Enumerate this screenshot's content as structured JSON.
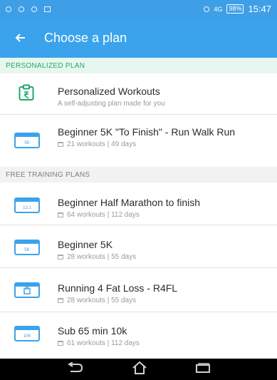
{
  "status_bar": {
    "network": "4G",
    "battery": "98%",
    "time": "15:47"
  },
  "app_bar": {
    "title": "Choose a plan",
    "back_icon": "back-arrow-icon"
  },
  "sections": {
    "personalized_header": "PERSONALIZED PLAN",
    "free_header": "FREE TRAINING PLANS"
  },
  "plans": [
    {
      "title": "Personalized Workouts",
      "subtitle": "A self-adjusting plan made for you",
      "icon": "personalized-icon"
    },
    {
      "title": "Beginner 5K \"To Finish\" -  Run Walk Run",
      "subtitle": "21 workouts | 49 days",
      "icon_label": "5K"
    },
    {
      "title": "Beginner Half Marathon to finish",
      "subtitle": "64 workouts | 112 days",
      "icon_label": "13.1"
    },
    {
      "title": "Beginner 5K",
      "subtitle": "28 workouts | 55 days",
      "icon_label": "5K"
    },
    {
      "title": "Running 4 Fat Loss - R4FL",
      "subtitle": "28 workouts | 55 days",
      "icon_label": ""
    },
    {
      "title": "Sub 65 min 10k",
      "subtitle": "61 workouts | 112 days",
      "icon_label": "10K"
    }
  ],
  "colors": {
    "app_bar": "#3aa3ec",
    "accent_green": "#1fa86a",
    "plan_icon": "#3aa3ec"
  }
}
